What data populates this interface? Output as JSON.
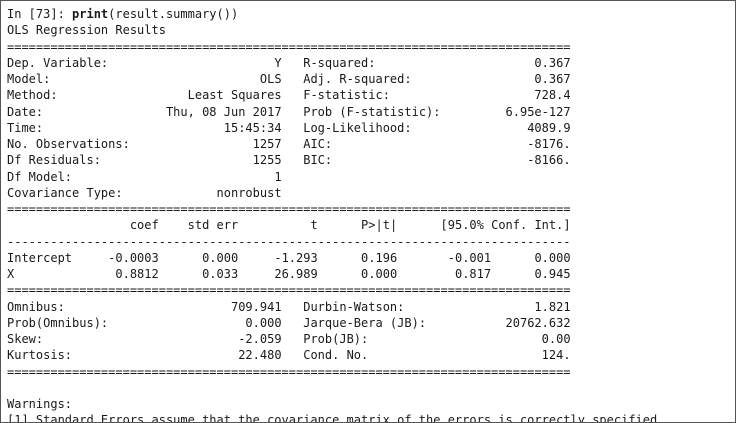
{
  "prompt": {
    "label": "In [73]:",
    "call_fn": "print",
    "call_args": "(result.summary())"
  },
  "title": "OLS Regression Results",
  "separator_double": "==============================================================================",
  "separator_single": "------------------------------------------------------------------------------",
  "model_info": {
    "left": [
      {
        "label": "Dep. Variable:",
        "value": "Y"
      },
      {
        "label": "Model:",
        "value": "OLS"
      },
      {
        "label": "Method:",
        "value": "Least Squares"
      },
      {
        "label": "Date:",
        "value": "Thu, 08 Jun 2017"
      },
      {
        "label": "Time:",
        "value": "15:45:34"
      },
      {
        "label": "No. Observations:",
        "value": "1257"
      },
      {
        "label": "Df Residuals:",
        "value": "1255"
      },
      {
        "label": "Df Model:",
        "value": "1"
      },
      {
        "label": "Covariance Type:",
        "value": "nonrobust"
      }
    ],
    "right": [
      {
        "label": "R-squared:",
        "value": "0.367"
      },
      {
        "label": "Adj. R-squared:",
        "value": "0.367"
      },
      {
        "label": "F-statistic:",
        "value": "728.4"
      },
      {
        "label": "Prob (F-statistic):",
        "value": "6.95e-127"
      },
      {
        "label": "Log-Likelihood:",
        "value": "4089.9"
      },
      {
        "label": "AIC:",
        "value": "-8176."
      },
      {
        "label": "BIC:",
        "value": "-8166."
      }
    ]
  },
  "coef_table": {
    "headers": [
      "",
      "coef",
      "std err",
      "t",
      "P>|t|",
      "[95.0% Conf. Int.]"
    ],
    "rows": [
      {
        "name": "Intercept",
        "coef": "-0.0003",
        "std_err": "0.000",
        "t": "-1.293",
        "p": "0.196",
        "ci_low": "-0.001",
        "ci_high": "0.000"
      },
      {
        "name": "X",
        "coef": "0.8812",
        "std_err": "0.033",
        "t": "26.989",
        "p": "0.000",
        "ci_low": "0.817",
        "ci_high": "0.945"
      }
    ]
  },
  "diagnostics": {
    "left": [
      {
        "label": "Omnibus:",
        "value": "709.941"
      },
      {
        "label": "Prob(Omnibus):",
        "value": "0.000"
      },
      {
        "label": "Skew:",
        "value": "-2.059"
      },
      {
        "label": "Kurtosis:",
        "value": "22.480"
      }
    ],
    "right": [
      {
        "label": "Durbin-Watson:",
        "value": "1.821"
      },
      {
        "label": "Jarque-Bera (JB):",
        "value": "20762.632"
      },
      {
        "label": "Prob(JB):",
        "value": "0.00"
      },
      {
        "label": "Cond. No.",
        "value": "124."
      }
    ]
  },
  "warnings": {
    "title": "Warnings:",
    "items": [
      "[1] Standard Errors assume that the covariance matrix of the errors is correctly specified."
    ]
  }
}
